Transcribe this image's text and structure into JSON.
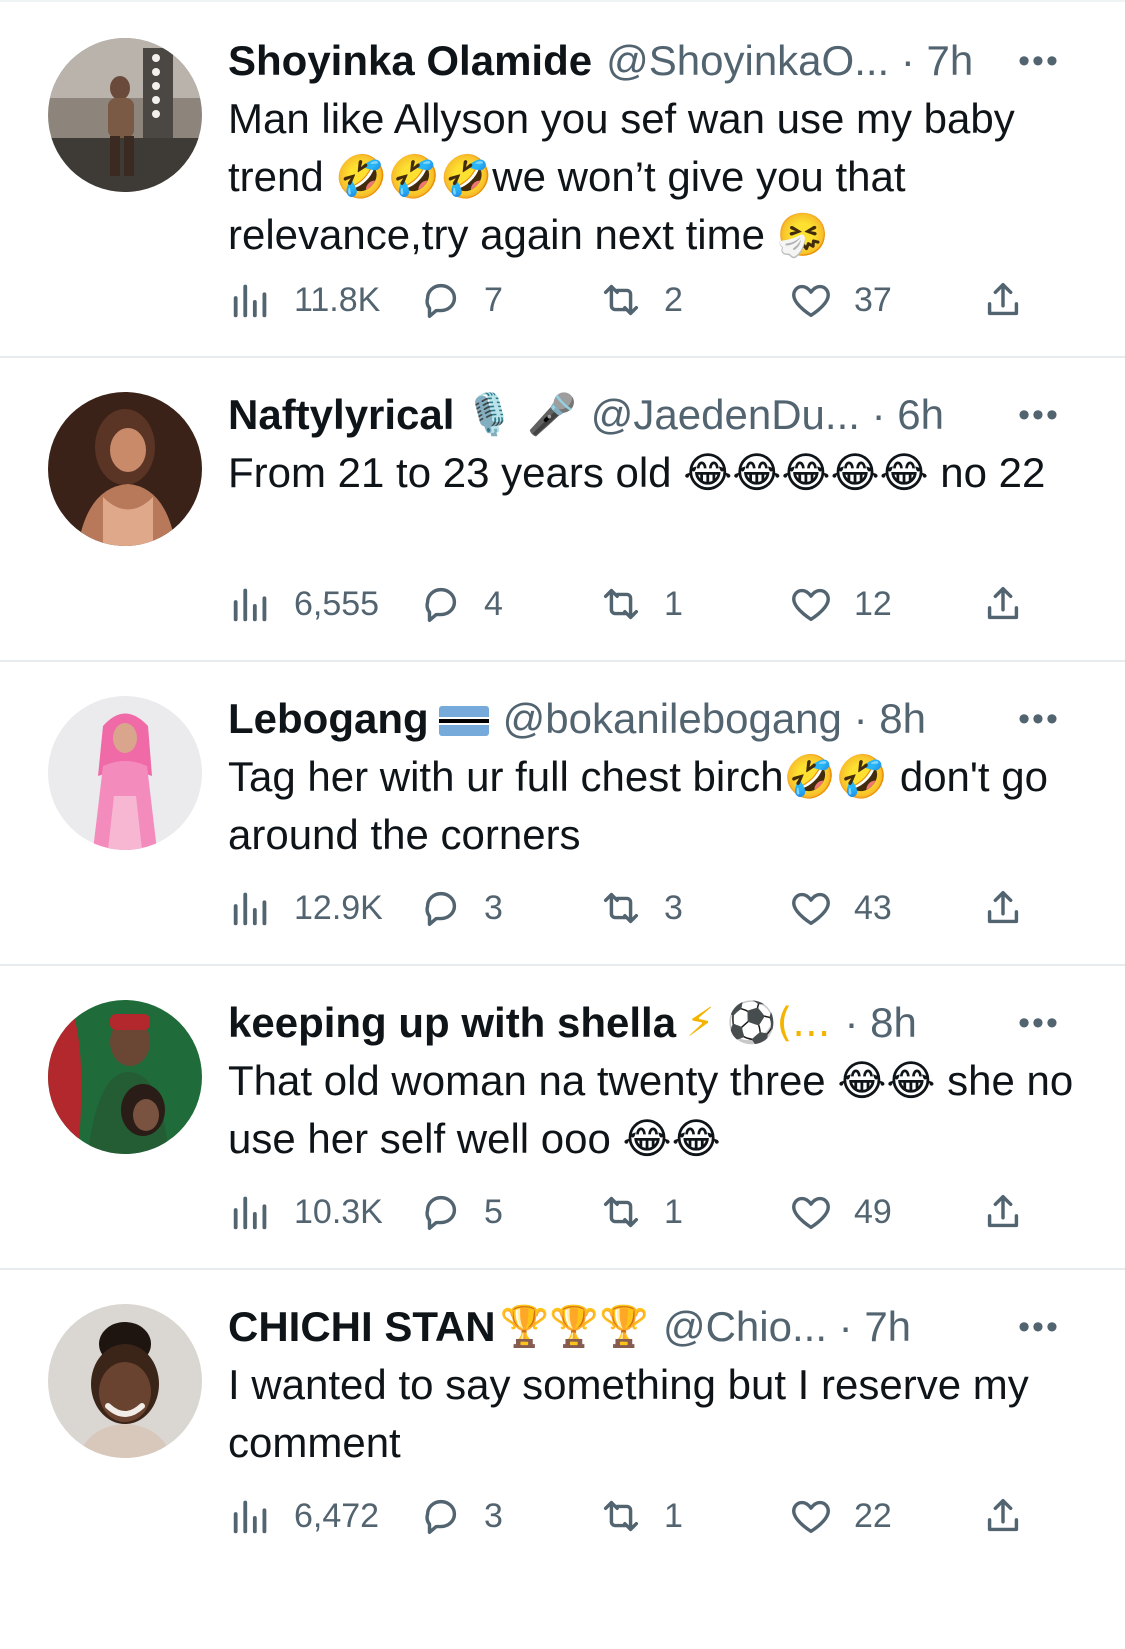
{
  "tweets": [
    {
      "display_name": "Shoyinka Olamide",
      "badges": "",
      "handle": "@ShoyinkaO...",
      "time": "7h",
      "text": "Man like Allyson you sef wan use my baby trend 🤣🤣🤣we won’t give you that relevance,try again next time 🤧",
      "views": "11.8K",
      "replies": "7",
      "retweets": "2",
      "likes": "37",
      "avatar_colors": [
        "#7a7066",
        "#d7d2cb",
        "#3e3a36"
      ]
    },
    {
      "display_name": "Naftylyrical",
      "badges": "🎙️ 🎤",
      "handle": "@JaedenDu...",
      "time": "6h",
      "text": "From 21 to 23 years old 😂😂😂😂😂 no 22",
      "views": "6,555",
      "replies": "4",
      "retweets": "1",
      "likes": "12",
      "avatar_colors": [
        "#4a2a1c",
        "#b8785a",
        "#e0a88a"
      ]
    },
    {
      "display_name": "Lebogang",
      "badges": "🇧🇼",
      "handle": "@bokanilebogang",
      "time": "8h",
      "text": "Tag her with ur full chest birch🤣🤣 don't go around the corners",
      "views": "12.9K",
      "replies": "3",
      "retweets": "3",
      "likes": "43",
      "avatar_colors": [
        "#e9e9ec",
        "#f06aa8",
        "#f7b6d2"
      ]
    },
    {
      "display_name": "keeping up with shella",
      "badges": "⚡ ⚽(...",
      "handle": "",
      "time": "8h",
      "text": "That old woman na twenty three 😂😂 she no use her self well ooo 😂😂",
      "views": "10.3K",
      "replies": "5",
      "retweets": "1",
      "likes": "49",
      "avatar_colors": [
        "#1f6b3a",
        "#b3282d",
        "#2a1c16"
      ]
    },
    {
      "display_name": "CHICHI STAN",
      "badges": "🏆🏆🏆",
      "handle": "@Chio...",
      "time": "7h",
      "text": "I wanted to say something but I reserve my comment",
      "views": "6,472",
      "replies": "3",
      "retweets": "1",
      "likes": "22",
      "avatar_colors": [
        "#dad6d2",
        "#3b2418",
        "#f1ece8"
      ]
    }
  ],
  "icons": {
    "views": "views-chart-icon",
    "reply": "reply-bubble-icon",
    "retweet": "retweet-arrows-icon",
    "like": "heart-icon",
    "share": "share-upload-icon",
    "more": "more-dots-icon"
  },
  "colors": {
    "text_primary": "#0f1419",
    "text_secondary": "#536471",
    "divider": "#e7ebed"
  }
}
